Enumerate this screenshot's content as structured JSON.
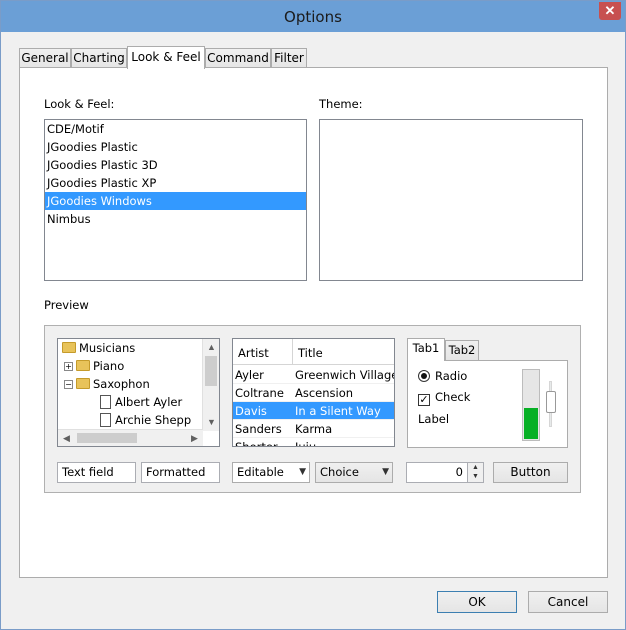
{
  "window": {
    "title": "Options",
    "close_glyph": "✕"
  },
  "tabs": [
    {
      "label": "General"
    },
    {
      "label": "Charting"
    },
    {
      "label": "Look & Feel"
    },
    {
      "label": "Command"
    },
    {
      "label": "Filter"
    }
  ],
  "look_feel": {
    "label": "Look & Feel:",
    "items": [
      "CDE/Motif",
      "JGoodies Plastic",
      "JGoodies Plastic 3D",
      "JGoodies Plastic XP",
      "JGoodies Windows",
      "Nimbus"
    ],
    "selected": "JGoodies Windows"
  },
  "theme": {
    "label": "Theme:"
  },
  "preview": {
    "label": "Preview",
    "tree": {
      "root": "Musicians",
      "child1": "Piano",
      "child2": "Saxophon",
      "leaf1": "Albert Ayler",
      "leaf2": "Archie Shepp"
    },
    "table": {
      "col_artist": "Artist",
      "col_title": "Title",
      "rows": [
        {
          "artist": "Ayler",
          "title": "Greenwich Village"
        },
        {
          "artist": "Coltrane",
          "title": "Ascension"
        },
        {
          "artist": "Davis",
          "title": "In a Silent Way"
        },
        {
          "artist": "Sanders",
          "title": "Karma"
        },
        {
          "artist": "Shorter",
          "title": "Juju"
        }
      ],
      "selected_row": 2
    },
    "mini_tabs": {
      "tab1": "Tab1",
      "tab2": "Tab2"
    },
    "radio_label": "Radio",
    "check_label": "Check",
    "check_mark": "✓",
    "label_text": "Label",
    "progress_fraction": 0.45,
    "text_field": "Text field",
    "formatted_field": "Formatted",
    "editable_combo": "Editable",
    "choice_combo": "Choice",
    "spinner_value": "0",
    "button_label": "Button"
  },
  "footer": {
    "ok": "OK",
    "cancel": "Cancel"
  },
  "colors": {
    "selection": "#3399ff",
    "progress": "#06b025",
    "titlebar": "#6b9fd6"
  }
}
